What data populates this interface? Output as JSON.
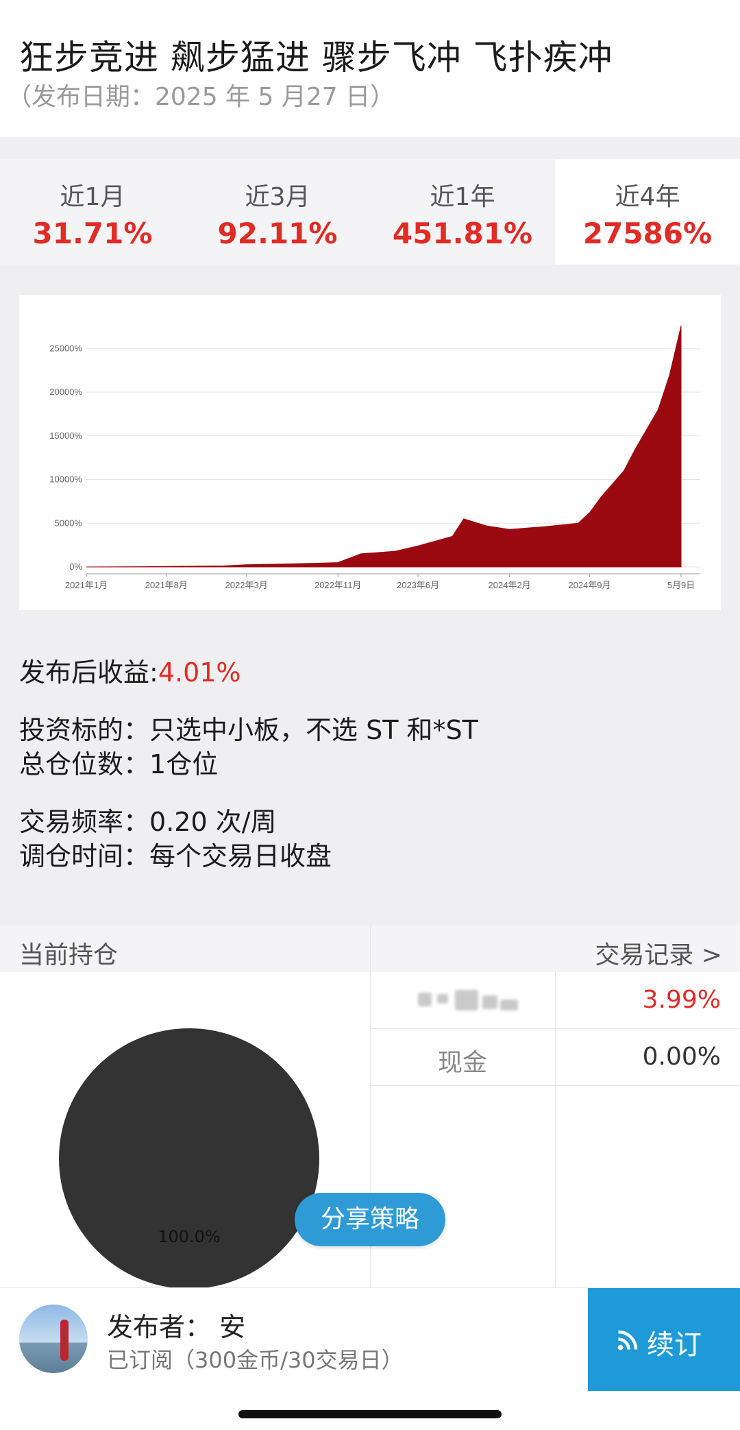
{
  "header": {
    "title": "狂步竞进 飙步猛进 骤步飞冲 飞扑疾冲",
    "date": "（发布日期：2025 年 5 月27 日）"
  },
  "performance": [
    {
      "label": "近1月",
      "value": "31.71%"
    },
    {
      "label": "近3月",
      "value": "92.11%"
    },
    {
      "label": "近1年",
      "value": "451.81%"
    },
    {
      "label": "近4年",
      "value": "27586%",
      "active": true
    }
  ],
  "chart_data": {
    "type": "area",
    "color": "#9b0a10",
    "y_ticks": [
      "0%",
      "5000%",
      "10000%",
      "15000%",
      "20000%",
      "25000%"
    ],
    "x_ticks": [
      "2021年1月",
      "2021年8月",
      "2022年3月",
      "2022年11月",
      "2023年6月",
      "2024年2月",
      "2024年9月",
      "5月9日"
    ],
    "ylim": [
      0,
      28000
    ],
    "grid": true,
    "x": [
      "2021-01",
      "2021-06",
      "2021-08",
      "2022-01",
      "2022-03",
      "2022-07",
      "2022-11",
      "2023-01",
      "2023-04",
      "2023-06",
      "2023-09",
      "2023-10",
      "2023-12",
      "2024-02",
      "2024-05",
      "2024-08",
      "2024-09",
      "2024-10",
      "2024-12",
      "2025-01",
      "2025-03",
      "2025-04",
      "2025-05"
    ],
    "values": [
      0,
      30,
      60,
      120,
      250,
      350,
      500,
      1500,
      1800,
      2400,
      3500,
      5500,
      4700,
      4300,
      4600,
      5000,
      6200,
      8000,
      11000,
      13500,
      18000,
      22000,
      27586
    ]
  },
  "info": {
    "return_label": "发布后收益:",
    "return_value": "4.01%",
    "target_label": "投资标的：",
    "target_value": "只选中小板，不选 ST 和*ST",
    "positions_label": "总仓位数：",
    "positions_value": "1仓位",
    "frequency_label": "交易频率：",
    "frequency_value": "0.20 次/周",
    "rebalance_label": "调仓时间：",
    "rebalance_value": "每个交易日收盘"
  },
  "holdings": {
    "title": "当前持仓",
    "trade_record": "交易记录 >",
    "rows": [
      {
        "name": "",
        "value": "3.99%",
        "red": true
      },
      {
        "name": "现金",
        "value": "0.00%",
        "red": false
      }
    ],
    "pie_label": "100.0%"
  },
  "share_button": "分享策略",
  "footer": {
    "publisher": "发布者：  安",
    "subscription": "已订阅（300金币/30交易日）",
    "renew": "续订"
  }
}
